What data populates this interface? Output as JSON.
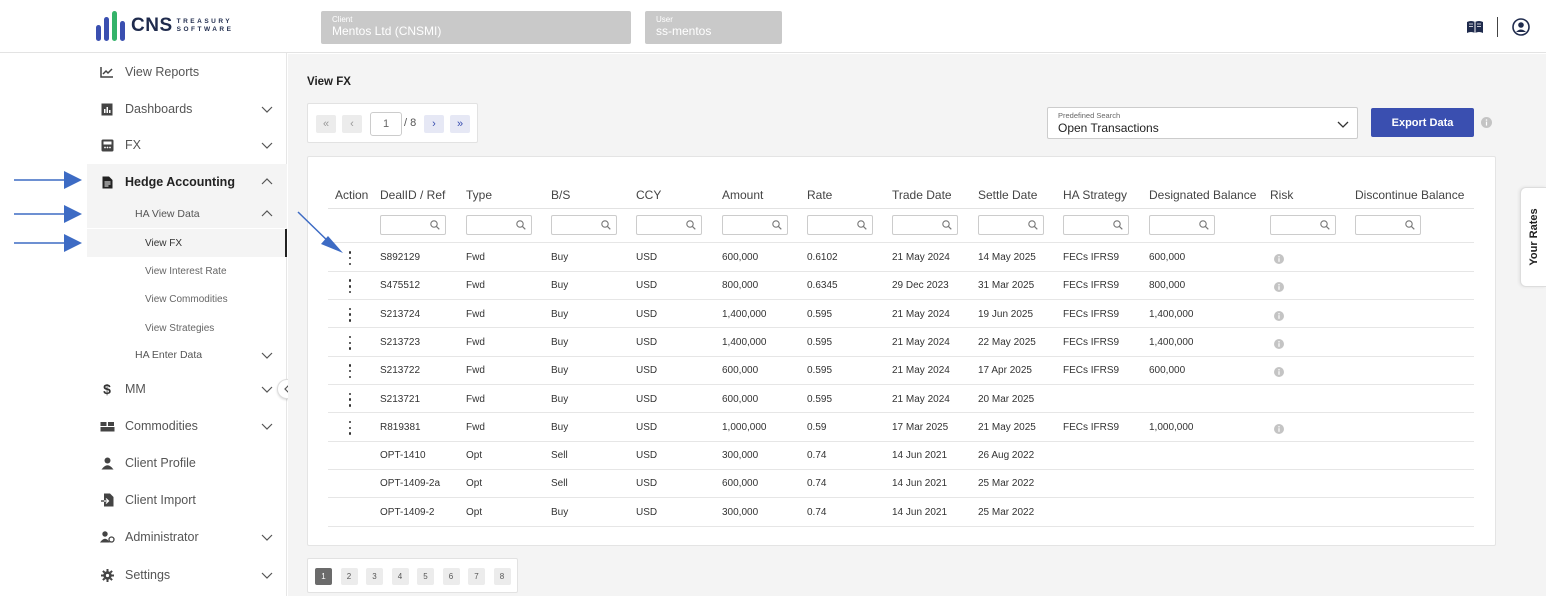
{
  "brand": {
    "name": "CNS",
    "sub_line1": "TREASURY",
    "sub_line2": "SOFTWARE",
    "bar_colors": [
      "#3a4fb0",
      "#3a4fb0",
      "#34b36a",
      "#3a4fb0"
    ]
  },
  "header": {
    "client_label": "Client",
    "client_value": "Mentos Ltd (CNSMI)",
    "user_label": "User",
    "user_value": "ss-mentos",
    "icons": [
      "book-icon",
      "user-circle-icon"
    ]
  },
  "sidebar": {
    "items": [
      {
        "label": "View Reports",
        "icon": "chart-line-icon"
      },
      {
        "label": "Dashboards",
        "icon": "dashboard-icon"
      },
      {
        "label": "FX",
        "icon": "calculator-icon"
      },
      {
        "label": "Hedge Accounting",
        "icon": "document-icon"
      },
      {
        "label": "MM",
        "icon": "dollar-icon"
      },
      {
        "label": "Commodities",
        "icon": "boxes-icon"
      },
      {
        "label": "Client Profile",
        "icon": "user-icon"
      },
      {
        "label": "Client Import",
        "icon": "import-icon"
      },
      {
        "label": "Administrator",
        "icon": "user-cog-icon"
      },
      {
        "label": "Settings",
        "icon": "gear-icon"
      }
    ],
    "hedge_sub": {
      "view_data": "HA View Data",
      "enter_data": "HA Enter Data",
      "children": [
        "View FX",
        "View Interest Rate",
        "View Commodities",
        "View Strategies"
      ]
    }
  },
  "main": {
    "title": "View FX",
    "pager": {
      "current": "1",
      "total": "/ 8",
      "first": "«",
      "prev": "‹",
      "next": "›",
      "last": "»"
    },
    "predefined_search": {
      "label": "Predefined Search",
      "value": "Open Transactions"
    },
    "export_label": "Export Data",
    "columns": [
      "Action",
      "DealID / Ref",
      "Type",
      "B/S",
      "CCY",
      "Amount",
      "Rate",
      "Trade Date",
      "Settle Date",
      "HA Strategy",
      "Designated Balance",
      "Risk",
      "Discontinue Balance"
    ],
    "rows": [
      {
        "action": true,
        "id": "S892129",
        "type": "Fwd",
        "bs": "Buy",
        "ccy": "USD",
        "amount": "600,000",
        "rate": "0.6102",
        "trade": "21 May 2024",
        "settle": "14 May 2025",
        "strategy": "FECs IFRS9",
        "designated": "600,000",
        "risk": true
      },
      {
        "action": true,
        "id": "S475512",
        "type": "Fwd",
        "bs": "Buy",
        "ccy": "USD",
        "amount": "800,000",
        "rate": "0.6345",
        "trade": "29 Dec 2023",
        "settle": "31 Mar 2025",
        "strategy": "FECs IFRS9",
        "designated": "800,000",
        "risk": true
      },
      {
        "action": true,
        "id": "S213724",
        "type": "Fwd",
        "bs": "Buy",
        "ccy": "USD",
        "amount": "1,400,000",
        "rate": "0.595",
        "trade": "21 May 2024",
        "settle": "19 Jun 2025",
        "strategy": "FECs IFRS9",
        "designated": "1,400,000",
        "risk": true
      },
      {
        "action": true,
        "id": "S213723",
        "type": "Fwd",
        "bs": "Buy",
        "ccy": "USD",
        "amount": "1,400,000",
        "rate": "0.595",
        "trade": "21 May 2024",
        "settle": "22 May 2025",
        "strategy": "FECs IFRS9",
        "designated": "1,400,000",
        "risk": true
      },
      {
        "action": true,
        "id": "S213722",
        "type": "Fwd",
        "bs": "Buy",
        "ccy": "USD",
        "amount": "600,000",
        "rate": "0.595",
        "trade": "21 May 2024",
        "settle": "17 Apr 2025",
        "strategy": "FECs IFRS9",
        "designated": "600,000",
        "risk": true
      },
      {
        "action": true,
        "id": "S213721",
        "type": "Fwd",
        "bs": "Buy",
        "ccy": "USD",
        "amount": "600,000",
        "rate": "0.595",
        "trade": "21 May 2024",
        "settle": "20 Mar 2025",
        "strategy": "",
        "designated": "",
        "risk": false
      },
      {
        "action": true,
        "id": "R819381",
        "type": "Fwd",
        "bs": "Buy",
        "ccy": "USD",
        "amount": "1,000,000",
        "rate": "0.59",
        "trade": "17 Mar 2025",
        "settle": "21 May 2025",
        "strategy": "FECs IFRS9",
        "designated": "1,000,000",
        "risk": true
      },
      {
        "action": false,
        "id": "OPT-1410",
        "type": "Opt",
        "bs": "Sell",
        "ccy": "USD",
        "amount": "300,000",
        "rate": "0.74",
        "trade": "14 Jun 2021",
        "settle": "26 Aug 2022",
        "strategy": "",
        "designated": "",
        "risk": false
      },
      {
        "action": false,
        "id": "OPT-1409-2a",
        "type": "Opt",
        "bs": "Sell",
        "ccy": "USD",
        "amount": "600,000",
        "rate": "0.74",
        "trade": "14 Jun 2021",
        "settle": "25 Mar 2022",
        "strategy": "",
        "designated": "",
        "risk": false
      },
      {
        "action": false,
        "id": "OPT-1409-2",
        "type": "Opt",
        "bs": "Buy",
        "ccy": "USD",
        "amount": "300,000",
        "rate": "0.74",
        "trade": "14 Jun 2021",
        "settle": "25 Mar 2022",
        "strategy": "",
        "designated": "",
        "risk": false
      }
    ],
    "pages": [
      "1",
      "2",
      "3",
      "4",
      "5",
      "6",
      "7",
      "8"
    ],
    "current_page": "1"
  },
  "side_tab": {
    "label": "Your Rates"
  },
  "colors": {
    "accent": "#3a4fb0",
    "annotation_arrow": "#3d6bc4"
  }
}
